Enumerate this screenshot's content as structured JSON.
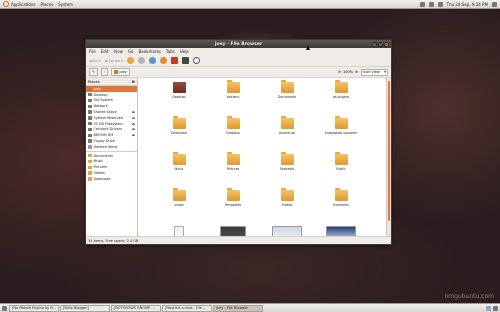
{
  "top_panel": {
    "menus": [
      "Applications",
      "Places",
      "System"
    ],
    "clock": "Thu 24 Sep, 9:24 PM"
  },
  "window": {
    "title": "joey - File Browser",
    "menu": [
      "File",
      "Edit",
      "View",
      "Go",
      "Bookmarks",
      "Tabs",
      "Help"
    ],
    "toolbar": {
      "back_label": "Back",
      "forward_label": "Forward"
    },
    "location": {
      "crumb": "joey"
    },
    "zoom": "100%",
    "view_mode": "Icon View",
    "sidebar": {
      "header": "Places",
      "items": [
        {
          "label": "joey",
          "icon": "home-icon",
          "selected": true
        },
        {
          "label": "Desktop",
          "icon": "desktop-icon"
        },
        {
          "label": "File System",
          "icon": "drive-icon"
        },
        {
          "label": "Network",
          "icon": "network-icon"
        },
        {
          "label": "Shared Space",
          "icon": "drive-icon",
          "eject": true
        },
        {
          "label": "System Reserved",
          "icon": "drive-icon",
          "eject": true
        },
        {
          "label": "95 GB Filesystem",
          "icon": "drive-icon",
          "eject": true
        },
        {
          "label": "CellularX Drivers",
          "icon": "drive-icon",
          "eject": true
        },
        {
          "label": "BROOKI 8/4",
          "icon": "drive-icon",
          "eject": true
        },
        {
          "label": "Floppy Drive",
          "icon": "floppy-icon"
        },
        {
          "label": "Deleted Items",
          "icon": "trash-icon"
        },
        {
          "label": "Documents",
          "icon": "folder-icon"
        },
        {
          "label": "Music",
          "icon": "folder-icon"
        },
        {
          "label": "Pictures",
          "icon": "folder-icon"
        },
        {
          "label": "Videos",
          "icon": "folder-icon"
        },
        {
          "label": "Download",
          "icon": "folder-icon"
        }
      ]
    },
    "files": [
      {
        "name": "Desktop",
        "type": "desktop"
      },
      {
        "name": "doclens",
        "type": "folder"
      },
      {
        "name": "Documents",
        "type": "folder"
      },
      {
        "name": "do.plugins",
        "type": "folder"
      },
      {
        "name": "Download",
        "type": "folder"
      },
      {
        "name": "Dropbox",
        "type": "folder"
      },
      {
        "name": "gnome-do",
        "type": "folder"
      },
      {
        "name": "imagestool.uploader",
        "type": "folder"
      },
      {
        "name": "Music",
        "type": "folder"
      },
      {
        "name": "Pictures",
        "type": "folder"
      },
      {
        "name": "Podcasts",
        "type": "folder"
      },
      {
        "name": "Public",
        "type": "folder"
      },
      {
        "name": "snaps",
        "type": "folder"
      },
      {
        "name": "Templates",
        "type": "folder"
      },
      {
        "name": "Videos",
        "type": "folder"
      },
      {
        "name": "Examples",
        "type": "folder"
      },
      {
        "name": "launchpad-update.sh",
        "type": "doc"
      },
      {
        "name": "screenshot_001.png",
        "type": "shot"
      },
      {
        "name": "screenshot_003.png",
        "type": "shot2"
      },
      {
        "name": "screenshot_004.png",
        "type": "shot3"
      }
    ],
    "status": "34 items, Free space: 2.4 GB"
  },
  "taskbar": {
    "tasks": [
      {
        "label": "[No Mobile Engine by B...",
        "active": false
      },
      {
        "label": "[Billie Blogger]",
        "active": false
      },
      {
        "label": "[BOTSHOWS GNOME ...",
        "active": false
      },
      {
        "label": "[Nautilus n.mps - File ...",
        "active": false
      },
      {
        "label": "joey - File Browser",
        "active": true
      }
    ]
  },
  "watermark": "omgubuntu.com"
}
